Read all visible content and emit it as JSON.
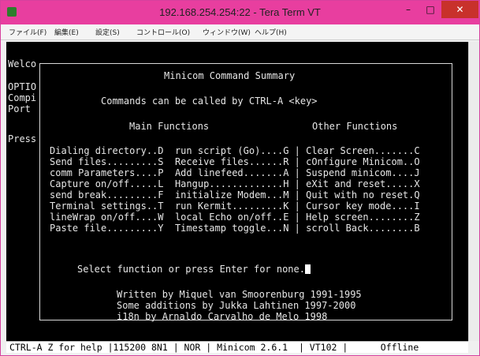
{
  "window": {
    "title": "192.168.254.254:22 - Tera Term VT",
    "minimize_label": "–",
    "maximize_label": "□",
    "close_label": "✕",
    "titlebar_color": "#e83e9f",
    "icon": "teraterm-icon"
  },
  "menu": {
    "items": [
      "ファイル(F)",
      "編集(E)",
      "設定(S)",
      "コントロール(O)",
      "ウィンドウ(W)",
      "ヘルプ(H)"
    ]
  },
  "terminal": {
    "left_fragments": [
      "Welco",
      "OPTIO",
      "Compi",
      "Port",
      "Press"
    ],
    "summary_title": "Minicom Command Summary",
    "subtitle": "Commands can be called by CTRL-A <key>",
    "main_header": "Main Functions",
    "other_header": "Other Functions",
    "rows": [
      "Dialing directory..D  run script (Go)....G | Clear Screen.......C",
      "Send files.........S  Receive files......R | cOnfigure Minicom..O",
      "comm Parameters....P  Add linefeed.......A | Suspend minicom....J",
      "Capture on/off.....L  Hangup.............H | eXit and reset.....X",
      "send break.........F  initialize Modem...M | Quit with no reset.Q",
      "Terminal settings..T  run Kermit.........K | Cursor key mode....I",
      "lineWrap on/off....W  local Echo on/off..E | Help screen........Z",
      "Paste file.........Y  Timestamp toggle...N | scroll Back........B"
    ],
    "prompt": "Select function or press Enter for none.",
    "credits": [
      "Written by Miquel van Smoorenburg 1991-1995",
      "Some additions by Jukka Lahtinen 1997-2000",
      "i18n by Arnaldo Carvalho de Melo 1998"
    ]
  },
  "status_bar": {
    "text": "CTRL-A Z for help |115200 8N1 | NOR | Minicom 2.6.1  | VT102 |      Offline"
  }
}
